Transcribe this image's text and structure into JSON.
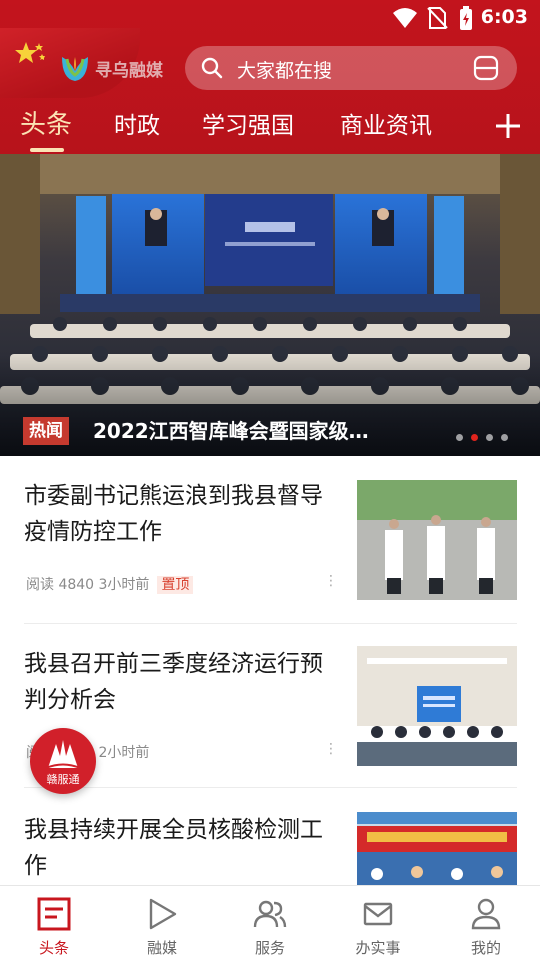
{
  "status_bar": {
    "time": "6:03"
  },
  "header": {
    "logo_text": "寻乌融媒",
    "search_placeholder": "大家都在搜",
    "tabs": [
      "头条",
      "时政",
      "学习强国",
      "商业资讯"
    ],
    "active_tab": "头条"
  },
  "banner": {
    "badge": "热闻",
    "title": "2022江西智库峰会暨国家级…",
    "slide_count": 4,
    "active_slide": 2
  },
  "news": [
    {
      "title": "市委副书记熊运浪到我县督导疫情防控工作",
      "meta": "阅读 4840  3小时前",
      "pin": "置顶"
    },
    {
      "title": "我县召开前三季度经济运行预判分析会",
      "meta": "阅读 4851  2小时前"
    },
    {
      "title": "我县持续开展全员核酸检测工作"
    }
  ],
  "fab": {
    "label": "赣服通"
  },
  "bottom_nav": [
    {
      "label": "头条",
      "icon": "news-icon"
    },
    {
      "label": "融媒",
      "icon": "play-icon"
    },
    {
      "label": "服务",
      "icon": "people-icon"
    },
    {
      "label": "办实事",
      "icon": "mail-icon"
    },
    {
      "label": "我的",
      "icon": "profile-icon"
    }
  ],
  "colors": {
    "brand": "#c3141d",
    "active_tab": "#fbe3b4",
    "pin": "#d8412f"
  }
}
